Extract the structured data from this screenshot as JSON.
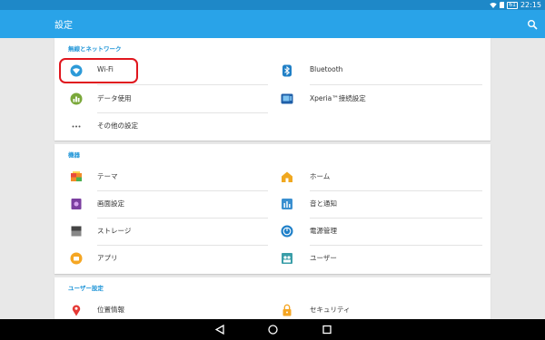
{
  "status": {
    "battery": "61",
    "time": "22:15"
  },
  "toolbar": {
    "title": "設定",
    "search_icon": "search-icon"
  },
  "colors": {
    "accent": "#29a3e8",
    "statusbar": "#1e88c8",
    "highlight": "#e0161e"
  },
  "sections": {
    "wireless": {
      "header": "無線とネットワーク",
      "items": [
        {
          "label": "Wi-Fi",
          "icon": "wifi-icon"
        },
        {
          "label": "Bluetooth",
          "icon": "bluetooth-icon"
        },
        {
          "label": "データ使用",
          "icon": "data-usage-icon"
        },
        {
          "label": "Xperia™接続設定",
          "icon": "xperia-connect-icon"
        },
        {
          "label": "その他の設定",
          "icon": "more-icon"
        }
      ]
    },
    "device": {
      "header": "機器",
      "items": [
        {
          "label": "テーマ",
          "icon": "theme-icon"
        },
        {
          "label": "ホーム",
          "icon": "home-icon"
        },
        {
          "label": "画面設定",
          "icon": "display-icon"
        },
        {
          "label": "音と通知",
          "icon": "sound-icon"
        },
        {
          "label": "ストレージ",
          "icon": "storage-icon"
        },
        {
          "label": "電源管理",
          "icon": "power-icon"
        },
        {
          "label": "アプリ",
          "icon": "apps-icon"
        },
        {
          "label": "ユーザー",
          "icon": "users-icon"
        }
      ]
    },
    "user": {
      "header": "ユーザー設定",
      "items": [
        {
          "label": "位置情報",
          "icon": "location-icon"
        },
        {
          "label": "セキュリティ",
          "icon": "security-icon"
        }
      ]
    }
  }
}
